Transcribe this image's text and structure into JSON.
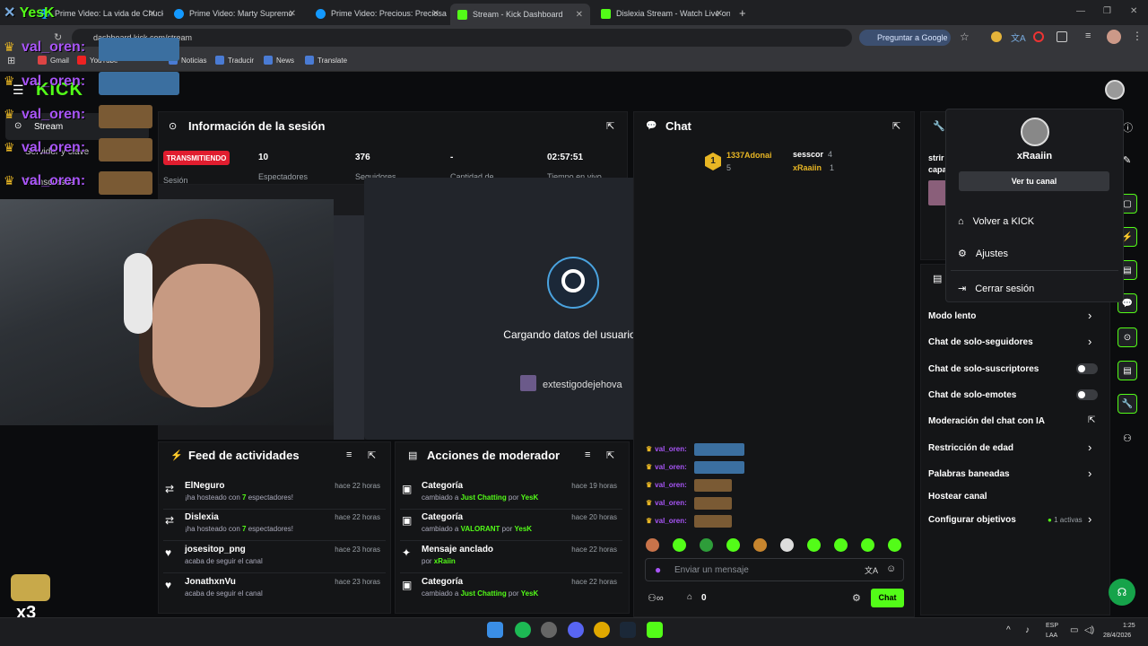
{
  "browser": {
    "tabs": [
      {
        "label": "Prime Video: La vida de Chuck"
      },
      {
        "label": "Prime Video: Marty Supremo"
      },
      {
        "label": "Prime Video: Precious: Preciosa"
      },
      {
        "label": "Stream - Kick Dashboard"
      },
      {
        "label": "Dislexia Stream - Watch Live on"
      }
    ],
    "new_tab": "+",
    "url": "dashboard.kick.com/stream",
    "ask_google": "Preguntar a Google",
    "bookmarks": [
      "Gmail",
      "YouTube",
      "Noticias",
      "Traducir",
      "News",
      "Translate"
    ]
  },
  "overlay": {
    "streamer": "YesK",
    "chat_name": "val_oren:",
    "badge_count": "x3"
  },
  "nav": {
    "logo": "KICK",
    "items": [
      "Stream",
      "Servidor y clave",
      "Transcursos"
    ]
  },
  "session": {
    "title": "Información de la sesión",
    "status": "TRANSMITIENDO",
    "status_label": "Sesión",
    "stats": [
      {
        "value": "10",
        "label": "Espectadores"
      },
      {
        "value": "376",
        "label": "Seguidores"
      },
      {
        "value": "-",
        "label": "Cantidad de"
      },
      {
        "value": "02:57:51",
        "label": "Tiempo en vivo"
      }
    ]
  },
  "steam_modal": {
    "loading": "Cargando datos del usuario...",
    "user": "extestigodejehova",
    "close": "×"
  },
  "chat": {
    "title": "Chat",
    "leaders": [
      {
        "name": "1337Adonai",
        "count": "5"
      },
      {
        "name": "sesscor",
        "count": "4"
      },
      {
        "name": "xRaaiin",
        "count": "1"
      }
    ],
    "lines": [
      "val_oren:",
      "val_oren:",
      "val_oren:",
      "val_oren:",
      "val_oren:"
    ],
    "placeholder": "Enviar un mensaje",
    "viewers": "0",
    "send": "Chat"
  },
  "feed": {
    "title": "Feed de actividades",
    "items": [
      {
        "name": "ElNeguro",
        "pre": "¡ha hosteado con ",
        "num": "7",
        "post": " espectadores!",
        "time": "hace 22 horas"
      },
      {
        "name": "Dislexia",
        "pre": "¡ha hosteado con ",
        "num": "7",
        "post": " espectadores!",
        "time": "hace 22 horas"
      },
      {
        "name": "josesitop_png",
        "pre": "acaba de seguir el canal",
        "num": "",
        "post": "",
        "time": "hace 23 horas"
      },
      {
        "name": "JonathxnVu",
        "pre": "acaba de seguir el canal",
        "num": "",
        "post": "",
        "time": "hace 23 horas"
      }
    ]
  },
  "mod": {
    "title": "Acciones de moderador",
    "items": [
      {
        "name": "Categoría",
        "pre": "cambiado a ",
        "hl": "Just Chatting",
        "mid": " por ",
        "by": "YesK",
        "time": "hace 19 horas"
      },
      {
        "name": "Categoría",
        "pre": "cambiado a ",
        "hl": "VALORANT",
        "mid": " por ",
        "by": "YesK",
        "time": "hace 20 horas"
      },
      {
        "name": "Mensaje anclado",
        "pre": "por ",
        "hl": "xRaiin",
        "mid": "",
        "by": "",
        "time": "hace 22 horas"
      },
      {
        "name": "Categoría",
        "pre": "cambiado a ",
        "hl": "Just Chatting",
        "mid": " por ",
        "by": "YesK",
        "time": "hace 22 horas"
      }
    ]
  },
  "settings": {
    "top_text": [
      "strir",
      "capa"
    ],
    "rows": [
      {
        "label": "Modo lento",
        "ctl": "chevron"
      },
      {
        "label": "Chat de solo-seguidores",
        "ctl": "chevron"
      },
      {
        "label": "Chat de solo-suscriptores",
        "ctl": "toggle"
      },
      {
        "label": "Chat de solo-emotes",
        "ctl": "toggle"
      },
      {
        "label": "Moderación del chat con IA",
        "ctl": "external"
      },
      {
        "label": "Restricción de edad",
        "ctl": "chevron"
      },
      {
        "label": "Palabras baneadas",
        "ctl": "chevron"
      },
      {
        "label": "Hostear canal",
        "ctl": "none"
      },
      {
        "label": "Configurar objetivos",
        "ctl": "chevron"
      }
    ],
    "goals_active": "1 activas"
  },
  "user_menu": {
    "username": "xRaaiin",
    "channel_btn": "Ver tu canal",
    "items": [
      "Volver a KICK",
      "Ajustes",
      "Cerrar sesión"
    ]
  },
  "taskbar": {
    "lang": "ESP",
    "lang2": "LAA",
    "time": "1:25",
    "date": "28/4/2026"
  },
  "colors": {
    "kick_green": "#53fc18",
    "live_red": "#e11d2f",
    "purple": "#a855f7",
    "gold": "#e8b624"
  }
}
